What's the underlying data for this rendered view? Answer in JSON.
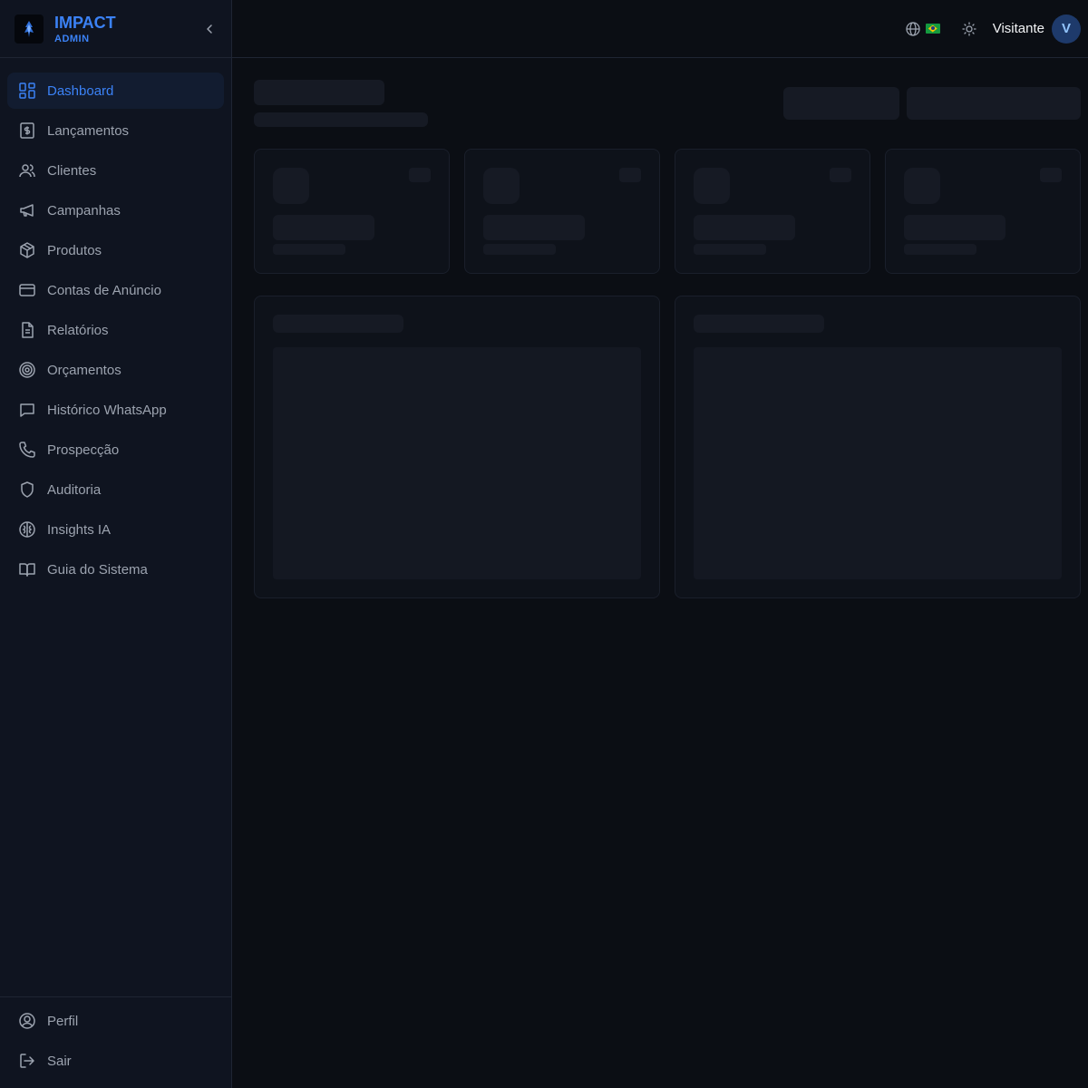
{
  "brand": {
    "title": "IMPACT",
    "subtitle": "ADMIN"
  },
  "sidebar": {
    "items": [
      {
        "label": "Dashboard",
        "icon": "dashboard-icon",
        "active": true
      },
      {
        "label": "Lançamentos",
        "icon": "dollar-receipt-icon"
      },
      {
        "label": "Clientes",
        "icon": "users-icon"
      },
      {
        "label": "Campanhas",
        "icon": "megaphone-icon"
      },
      {
        "label": "Produtos",
        "icon": "package-icon"
      },
      {
        "label": "Contas de Anúncio",
        "icon": "credit-card-icon"
      },
      {
        "label": "Relatórios",
        "icon": "file-text-icon"
      },
      {
        "label": "Orçamentos",
        "icon": "target-icon"
      },
      {
        "label": "Histórico WhatsApp",
        "icon": "chat-icon"
      },
      {
        "label": "Prospecção",
        "icon": "phone-icon"
      },
      {
        "label": "Auditoria",
        "icon": "shield-icon"
      },
      {
        "label": "Insights IA",
        "icon": "brain-icon"
      },
      {
        "label": "Guia do Sistema",
        "icon": "book-icon"
      }
    ],
    "bottom": [
      {
        "label": "Perfil",
        "icon": "user-circle-icon"
      },
      {
        "label": "Sair",
        "icon": "logout-icon"
      }
    ]
  },
  "header": {
    "user_name": "Visitante",
    "avatar_initial": "V",
    "language_flag": "brazil-flag-icon"
  },
  "colors": {
    "accent": "#3b82f6",
    "background": "#0b0e14",
    "sidebar": "#0f1420",
    "skeleton": "#161a24"
  }
}
